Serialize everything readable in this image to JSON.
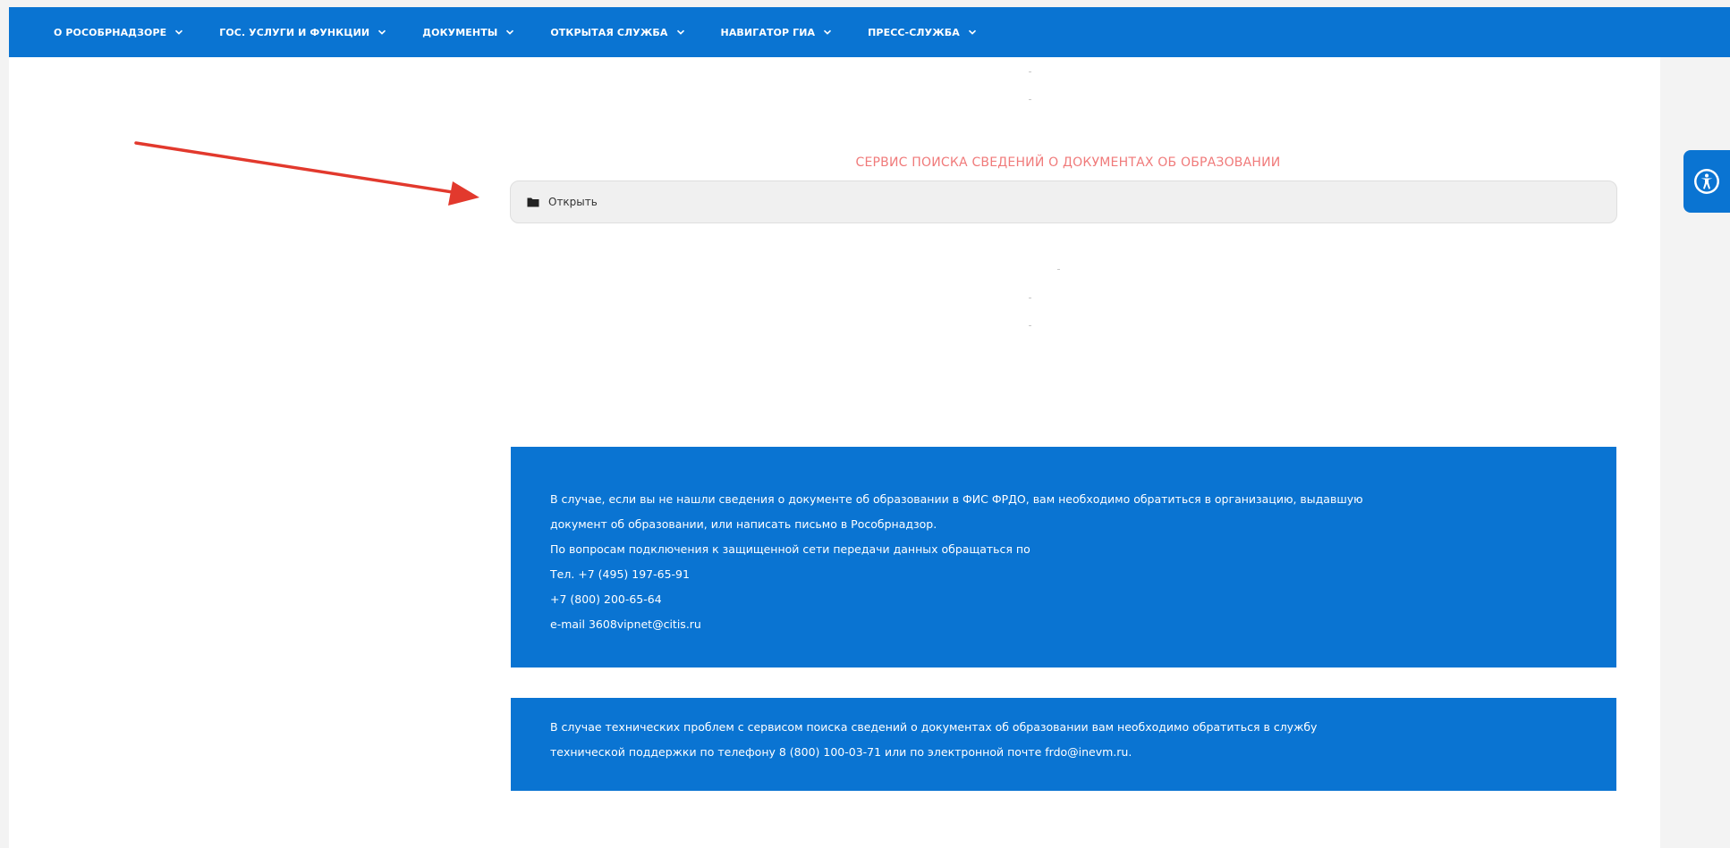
{
  "nav": {
    "items": [
      {
        "label": "О РОСОБРНАДЗОРЕ"
      },
      {
        "label": "ГОС. УСЛУГИ И ФУНКЦИИ"
      },
      {
        "label": "ДОКУМЕНТЫ"
      },
      {
        "label": "ОТКРЫТАЯ СЛУЖБА"
      },
      {
        "label": "НАВИГАТОР ГИА"
      },
      {
        "label": "ПРЕСС-СЛУЖБА"
      }
    ]
  },
  "service": {
    "title": "СЕРВИС ПОИСКА СВЕДЕНИЙ О ДОКУМЕНТАХ ОБ ОБРАЗОВАНИИ",
    "open_label": "Открыть"
  },
  "info1": {
    "lines": [
      "В случае, если вы не нашли сведения о документе об образовании в ФИС ФРДО, вам необходимо обратиться в организацию, выдавшую",
      "документ об образовании, или написать письмо в Рособрнадзор.",
      "По вопросам подключения к защищенной сети передачи данных обращаться по",
      "Тел. +7 (495) 197-65-91",
      "+7 (800) 200-65-64",
      "e-mail 3608vipnet@citis.ru"
    ]
  },
  "info2": {
    "lines": [
      "В случае технических проблем с сервисом поиска сведений о документах об образовании вам необходимо обратиться в службу",
      "технической поддержки по телефону  8 (800) 100-03-71 или по электронной почте frdo@inevm.ru."
    ]
  },
  "colors": {
    "brand_blue": "#0a74d2",
    "title_red": "#f07a7a",
    "arrow_red": "#e2392d"
  },
  "icons": {
    "open": "folder-icon",
    "accessibility": "accessibility-icon",
    "nav_chevron": "chevron-down-icon"
  }
}
